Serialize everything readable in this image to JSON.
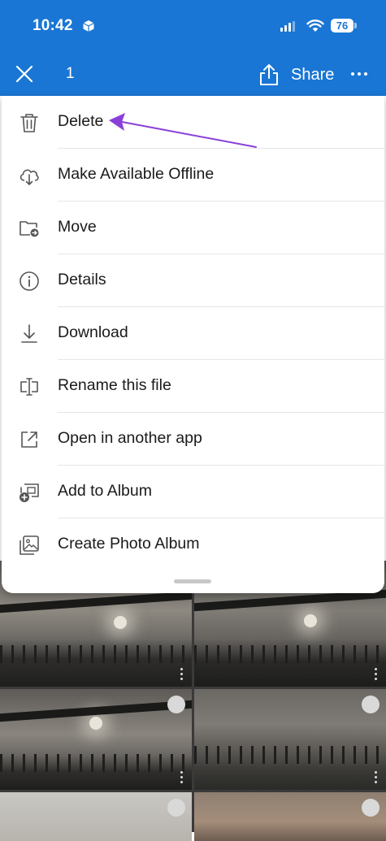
{
  "status_bar": {
    "time": "10:42",
    "battery": "76"
  },
  "header": {
    "selected_count": "1",
    "share_label": "Share"
  },
  "menu": {
    "items": [
      {
        "label": "Delete",
        "icon": "trash-icon"
      },
      {
        "label": "Make Available Offline",
        "icon": "cloud-download-icon"
      },
      {
        "label": "Move",
        "icon": "folder-move-icon"
      },
      {
        "label": "Details",
        "icon": "info-icon"
      },
      {
        "label": "Download",
        "icon": "download-icon"
      },
      {
        "label": "Rename this file",
        "icon": "rename-cursor-icon"
      },
      {
        "label": "Open in another app",
        "icon": "open-external-icon"
      },
      {
        "label": "Add to Album",
        "icon": "add-to-album-icon"
      },
      {
        "label": "Create Photo Album",
        "icon": "photo-album-icon"
      }
    ]
  },
  "colors": {
    "header_bg": "#1976d4",
    "annotation_arrow": "#8b3fd9"
  }
}
